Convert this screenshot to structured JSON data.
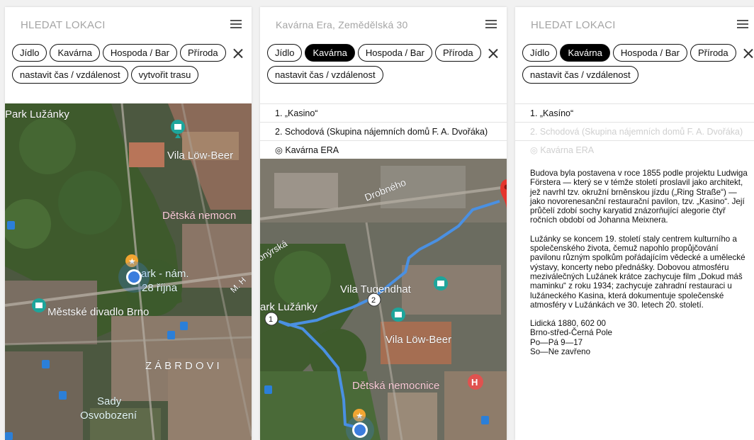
{
  "panels": [
    {
      "search": {
        "text": "HLEDAT LOKACI"
      },
      "chips_row1": [
        "Jídlo",
        "Kavárna",
        "Hospoda / Bar",
        "Příroda"
      ],
      "chips_row2": [
        "nastavit čas / vzdálenost",
        "vytvořit trasu"
      ],
      "map_labels": [
        "Park Lužánky",
        "Vila Löw-Beer",
        "Dětská nemocn",
        "ark - nám.",
        "28 října",
        "Městské divadlo Brno",
        "M. H",
        "ZÁBRDOVI",
        "Sady",
        "Osvobození"
      ]
    },
    {
      "search": {
        "text": "Kavárna Era, Zemědělská 30"
      },
      "chips_row1": [
        "Jídlo",
        "Kavárna",
        "Hospoda / Bar",
        "Příroda"
      ],
      "chips_row2": [
        "nastavit čas / vzdálenost"
      ],
      "stops": [
        "1. „Kasino“",
        "2. Schodová (Skupina nájemních domů F. A. Dvořáka)",
        "◎ Kavárna ERA"
      ],
      "map_labels": [
        "Drobného",
        "onýrská",
        "Vila Tugendhat",
        "ark Lužánky",
        "Vila Löw-Beer",
        "Dětská nemocnice"
      ],
      "route_markers": [
        "1",
        "2"
      ]
    },
    {
      "search": {
        "text": "HLEDAT LOKACI"
      },
      "chips_row1": [
        "Jídlo",
        "Kavárna",
        "Hospoda / Bar",
        "Příroda"
      ],
      "chips_row2": [
        "nastavit čas / vzdálenost"
      ],
      "stops": [
        "1. „Kasíno“",
        "2. Schodová (Skupina nájemních domů F. A. Dvořáka)",
        "◎ Kavárna ERA"
      ],
      "description": [
        "Budova byla postavena v roce 1855 podle projektu Ludwiga Förstera — který se v témže století proslavil jako architekt, jež navrhl tzv. okružní brněnskou jízdu („Ring Straße“) — jako novorenesanční restaurační pavilon, tzv. „Kasino“. Její průčelí zdobí sochy karyatid znázorňující alegorie čtyř ročních období od Johanna Meixnera.",
        "Lužánky se koncem 19. století staly centrem kulturního a společenského života, čemuž napohlo propůjčování pavilonu různým spolkům pořádajícím vědecké a umělecké výstavy, koncerty nebo přednášky. Dobovou atmosféru meziválečných Lužánek krátce zachycuje film „Dokud máš maminku“ z roku 1934; zachycuje zahradní restauraci u lužáneckého Kasina, která dokumentuje společenské atmosféry v Lužánkách ve 30. letech 20. století."
      ],
      "address": [
        "Lidická 1880, 602 00",
        "Brno-střed-Černá Pole",
        "Po—Pá 9—17",
        "So—Ne zavřeno"
      ]
    }
  ],
  "colors": {
    "active_chip": "#000000",
    "route": "#4a90e2",
    "location_dot": "#3b7ddd",
    "pin": "#e5352d",
    "poi_teal": "#1ea59b"
  }
}
